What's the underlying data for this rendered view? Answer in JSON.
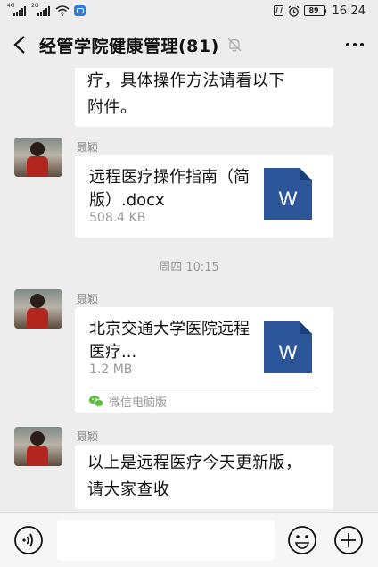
{
  "status_bar": {
    "sim1_gen": "4G",
    "sim2_gen": "2G",
    "battery": "89",
    "time": "16:24"
  },
  "header": {
    "title": "经管学院健康管理(81)"
  },
  "messages": [
    {
      "type": "text",
      "lines": [
        "疗，具体操作方法请看以下",
        "附件。"
      ]
    },
    {
      "type": "file",
      "sender": "聂颖",
      "file_name": "远程医疗操作指南（简版）.docx",
      "file_size": "508.4 KB",
      "icon": "word-icon"
    },
    {
      "type": "time",
      "text": "周四 10:15"
    },
    {
      "type": "file",
      "sender": "聂颖",
      "file_name": "北京交通大学医院远程医疗...",
      "file_size": "1.2 MB",
      "source": "微信电脑版",
      "icon": "word-icon"
    },
    {
      "type": "text",
      "sender": "聂颖",
      "lines": [
        "以上是远程医疗今天更新版，",
        "请大家查收"
      ]
    }
  ],
  "colors": {
    "background": "#ededed",
    "bubble": "#ffffff",
    "word_blue": "#2b579a",
    "wechat_green": "#5ebe3f"
  }
}
